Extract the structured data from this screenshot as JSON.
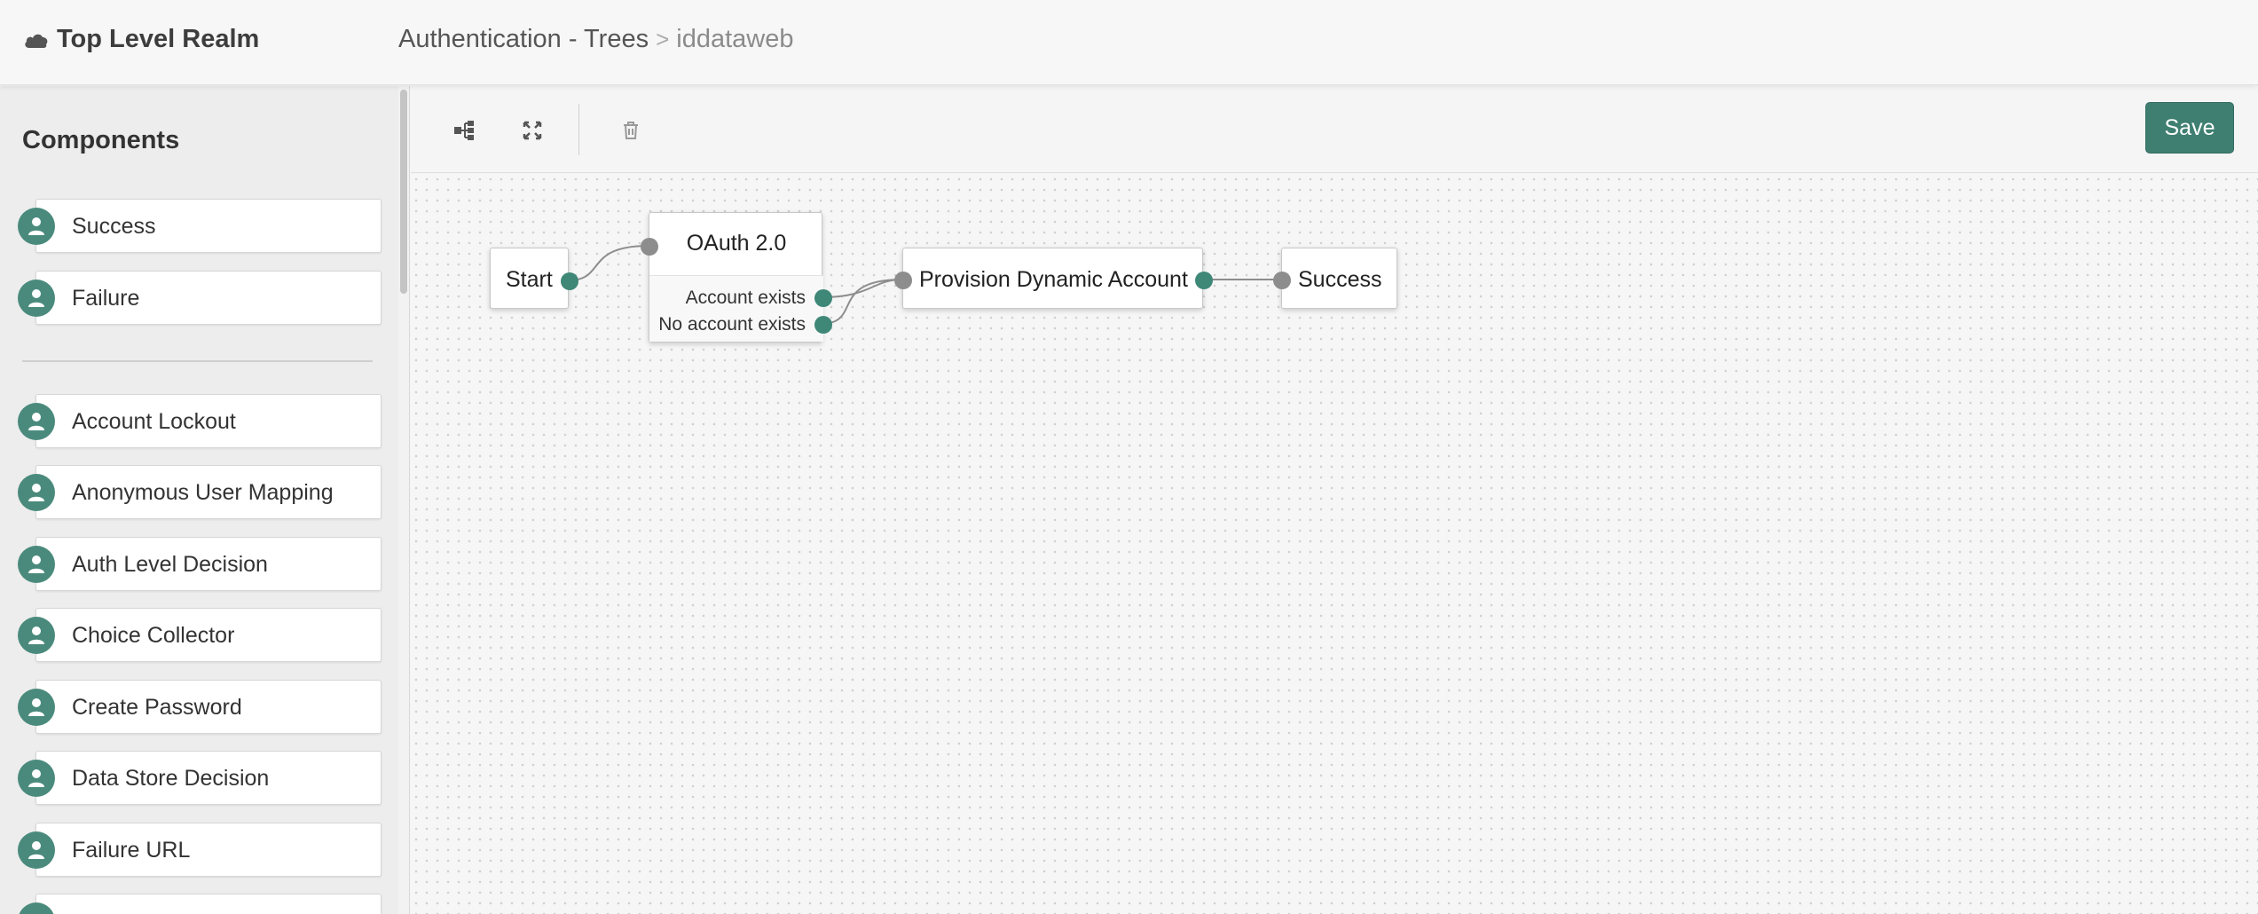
{
  "header": {
    "realm": "Top Level Realm",
    "breadcrumb": [
      "Authentication - Trees",
      "iddataweb"
    ],
    "separator": ">"
  },
  "sidebar": {
    "title": "Components",
    "pinned": [
      {
        "label": "Success",
        "icon": "user-icon"
      },
      {
        "label": "Failure",
        "icon": "user-icon"
      }
    ],
    "items": [
      {
        "label": "Account Lockout",
        "icon": "user-icon"
      },
      {
        "label": "Anonymous User Mapping",
        "icon": "user-icon"
      },
      {
        "label": "Auth Level Decision",
        "icon": "user-icon"
      },
      {
        "label": "Choice Collector",
        "icon": "user-icon"
      },
      {
        "label": "Create Password",
        "icon": "user-icon"
      },
      {
        "label": "Data Store Decision",
        "icon": "user-icon"
      },
      {
        "label": "Failure URL",
        "icon": "user-icon"
      }
    ]
  },
  "toolbar": {
    "tools": [
      "tree-layout-icon",
      "fit-to-screen-icon",
      "trash-icon"
    ],
    "save_label": "Save"
  },
  "tree": {
    "nodes": {
      "start": "Start",
      "oauth": {
        "title": "OAuth 2.0",
        "outcomes": [
          "Account exists",
          "No account exists"
        ]
      },
      "provision": "Provision Dynamic Account",
      "success": "Success"
    }
  },
  "colors": {
    "accent": "#3f7f71",
    "port_out": "#3f8777",
    "port_in": "#8d8d8d",
    "icon_bg": "#4a8a7c"
  }
}
